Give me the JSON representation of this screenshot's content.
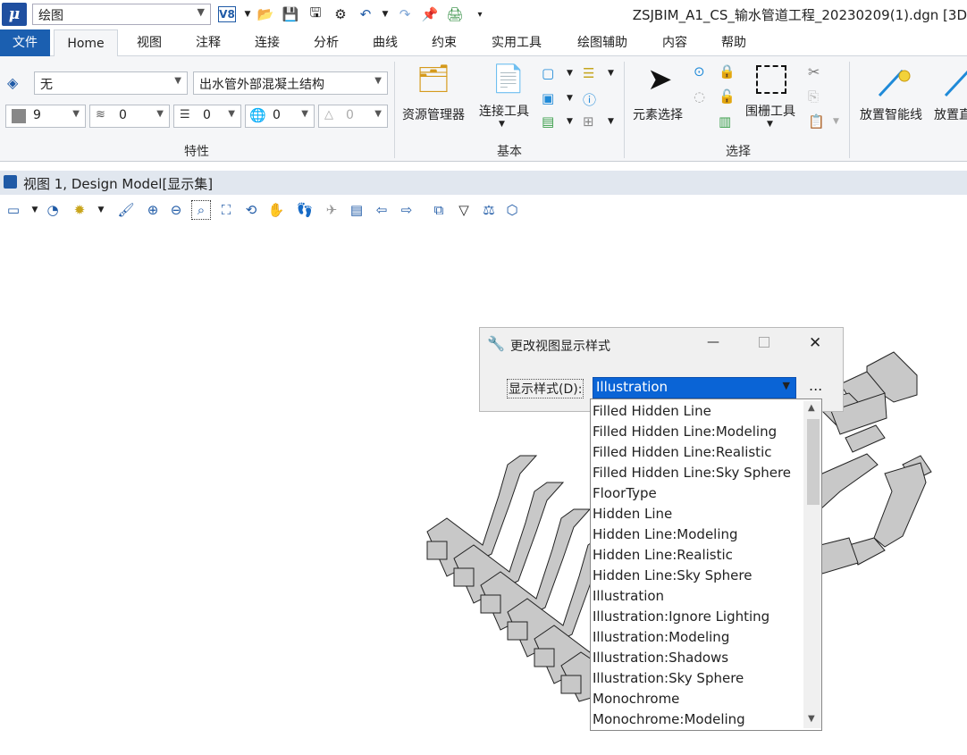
{
  "titlebar": {
    "workspace": "绘图",
    "document_title": "ZSJBIM_A1_CS_输水管道工程_20230209(1).dgn [3D"
  },
  "menu": [
    "文件",
    "Home",
    "视图",
    "注释",
    "连接",
    "分析",
    "曲线",
    "约束",
    "实用工具",
    "绘图辅助",
    "内容",
    "帮助"
  ],
  "ribbon": {
    "properties": {
      "level": "无",
      "template": "出水管外部混凝土结构",
      "color": "9",
      "style": "0",
      "weight": "0",
      "transparency": "0",
      "priority": "0",
      "group_label": "特性"
    },
    "basic": {
      "resource_manager": "资源管理器",
      "connect_tools": "连接工具",
      "group_label": "基本"
    },
    "selection": {
      "element_select": "元素选择",
      "fence_tool": "围栅工具",
      "group_label": "选择"
    },
    "placement": {
      "smart_line": "放置智能线",
      "place_cut": "放置直"
    }
  },
  "view": {
    "title": "视图 1, Design Model[显示集]"
  },
  "dialog": {
    "title": "更改视图显示样式",
    "label": "显示样式(D):",
    "selected": "Illustration",
    "more": "...",
    "options": [
      "Filled Hidden Line",
      "Filled Hidden Line:Modeling",
      "Filled Hidden Line:Realistic",
      "Filled Hidden Line:Sky Sphere",
      "FloorType",
      "Hidden Line",
      "Hidden Line:Modeling",
      "Hidden Line:Realistic",
      "Hidden Line:Sky Sphere",
      "Illustration",
      "Illustration:Ignore Lighting",
      "Illustration:Modeling",
      "Illustration:Shadows",
      "Illustration:Sky Sphere",
      "Monochrome",
      "Monochrome:Modeling"
    ]
  }
}
